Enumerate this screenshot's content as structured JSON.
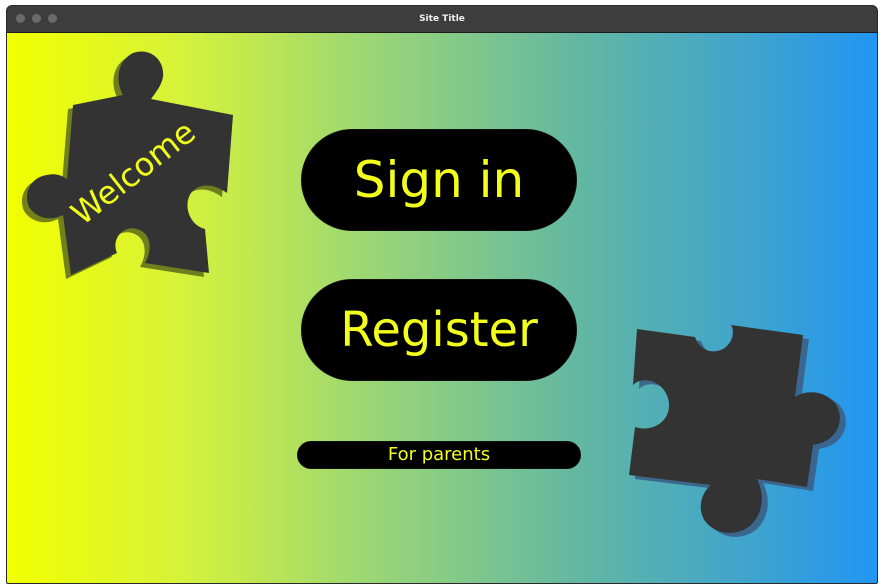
{
  "window": {
    "title": "Site Title"
  },
  "welcome_piece": {
    "label": "Welcome",
    "icon": "puzzle-piece-icon"
  },
  "decor_piece": {
    "icon": "puzzle-piece-icon"
  },
  "actions": {
    "sign_in_label": "Sign in",
    "register_label": "Register",
    "parents_label": "For parents"
  },
  "colors": {
    "gradient_start": "#f2ff00",
    "gradient_end": "#2196f3",
    "button_bg": "#000000",
    "button_text": "#f2ff1a",
    "puzzle_fill": "#333333"
  }
}
